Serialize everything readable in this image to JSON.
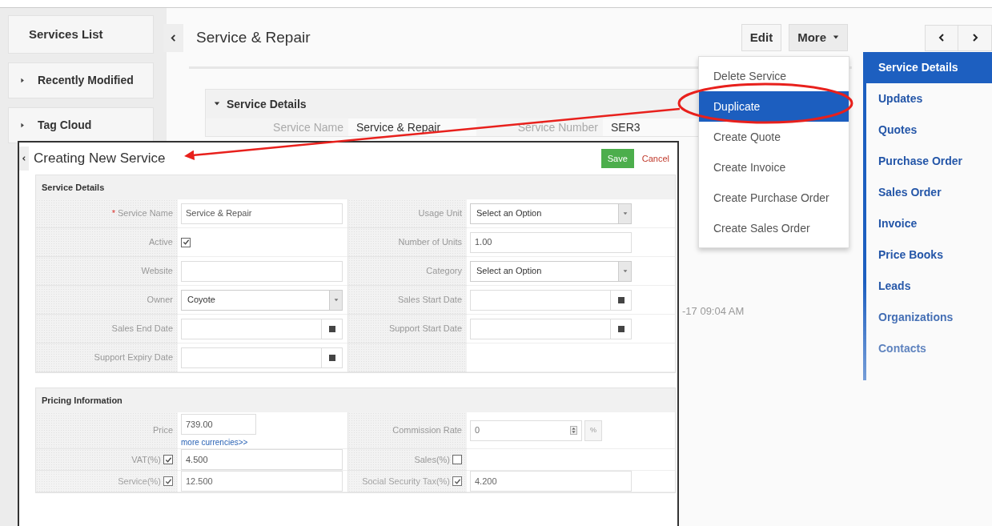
{
  "sidebar": {
    "title": "Services List",
    "items": [
      {
        "label": "Recently Modified",
        "expanded": false
      },
      {
        "label": "Tag Cloud",
        "expanded": false
      }
    ]
  },
  "header": {
    "title": "Service & Repair",
    "buttons": [
      {
        "label": "Edit",
        "kind": "plain"
      },
      {
        "label": "More",
        "kind": "menu"
      }
    ]
  },
  "more_menu": {
    "items": [
      {
        "label": "Delete Service",
        "selected": false
      },
      {
        "label": "Duplicate",
        "selected": true
      },
      {
        "label": "Create Quote",
        "selected": false
      },
      {
        "label": "Create Invoice",
        "selected": false
      },
      {
        "label": "Create Purchase Order",
        "selected": false
      },
      {
        "label": "Create Sales Order",
        "selected": false
      }
    ]
  },
  "detail_block": {
    "title": "Service Details",
    "expanded": true,
    "fields": [
      {
        "label": "Service Name",
        "value": "Service & Repair"
      },
      {
        "label": "Service Number",
        "value": "SER3"
      }
    ],
    "modified_fragment": "-17 09:04 AM"
  },
  "related_nav": [
    {
      "label": "Service Details",
      "selected": true
    },
    {
      "label": "Updates",
      "selected": false
    },
    {
      "label": "Quotes",
      "selected": false
    },
    {
      "label": "Purchase Order",
      "selected": false
    },
    {
      "label": "Sales Order",
      "selected": false
    },
    {
      "label": "Invoice",
      "selected": false
    },
    {
      "label": "Price Books",
      "selected": false
    },
    {
      "label": "Leads",
      "selected": false
    },
    {
      "label": "Organizations",
      "selected": false
    },
    {
      "label": "Contacts",
      "selected": false
    }
  ],
  "dialog": {
    "title": "Creating New Service",
    "save": "Save",
    "cancel": "Cancel",
    "sections": [
      {
        "title": "Service Details",
        "rows": [
          [
            {
              "label": "Service Name",
              "required_mark": "*",
              "kind": "input",
              "value": "Service & Repair"
            },
            {
              "label": "Usage Unit",
              "kind": "select",
              "value": "Select an Option"
            }
          ],
          [
            {
              "label": "Active",
              "kind": "checkbox",
              "checked": true
            },
            {
              "label": "Number of Units",
              "kind": "input",
              "value": "1.00"
            }
          ],
          [
            {
              "label": "Website",
              "kind": "input"
            },
            {
              "label": "Category",
              "kind": "select",
              "value": "Select an Option"
            }
          ],
          [
            {
              "label": "Owner",
              "kind": "select",
              "value": "Coyote"
            },
            {
              "label": "Sales Start Date",
              "kind": "date"
            }
          ],
          [
            {
              "label": "Sales End Date",
              "kind": "date"
            },
            {
              "label": "Support Start Date",
              "kind": "date"
            }
          ],
          [
            {
              "label": "Support Expiry Date",
              "kind": "date"
            },
            {
              "kind": "empty"
            }
          ]
        ]
      },
      {
        "title": "Pricing Information",
        "rows": [
          [
            {
              "label": "Price",
              "kind": "price",
              "value": "739.00",
              "link": "more currencies>>"
            },
            {
              "label": "Commission Rate",
              "kind": "spinner",
              "value": "0",
              "unit": "%"
            }
          ],
          [
            {
              "label": "VAT(%)",
              "kind": "tax",
              "checked": true,
              "value": "4.500"
            },
            {
              "label": "Sales(%)",
              "kind": "tax",
              "checked": false
            }
          ],
          [
            {
              "label": "Service(%)",
              "kind": "tax",
              "checked": true,
              "value": "12.500"
            },
            {
              "label": "Social Security Tax(%)",
              "kind": "tax",
              "checked": true,
              "value": "4.200"
            }
          ]
        ]
      }
    ]
  }
}
